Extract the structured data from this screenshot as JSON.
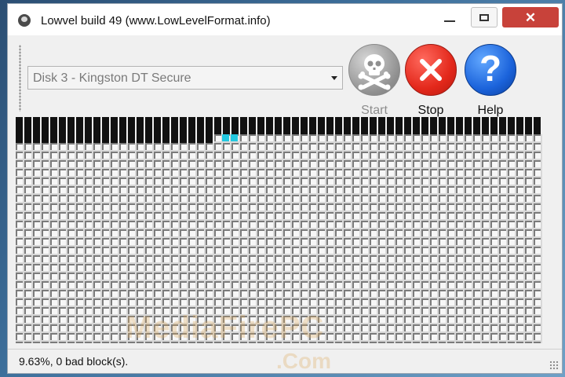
{
  "window": {
    "title": "Lowvel build 49 (www.LowLevelFormat.info)",
    "controls": {
      "minimize": "minimize",
      "maximize": "maximize",
      "close": "close"
    }
  },
  "toolbar": {
    "disk_select_value": "Disk 3 - Kingston DT Secure",
    "start_label": "Start",
    "stop_label": "Stop",
    "help_label": "Help",
    "help_glyph": "?",
    "start_icon": "skull-crossbones-icon",
    "stop_icon": "x-icon",
    "help_icon": "question-icon"
  },
  "block_map": {
    "colors": {
      "done": "#111111",
      "active": "#23c8e0",
      "pending": "#ffffff"
    }
  },
  "status": {
    "text": "9.63%, 0 bad block(s)."
  },
  "watermark": {
    "line1": "MediaFirePC",
    "line2": ".Com"
  }
}
